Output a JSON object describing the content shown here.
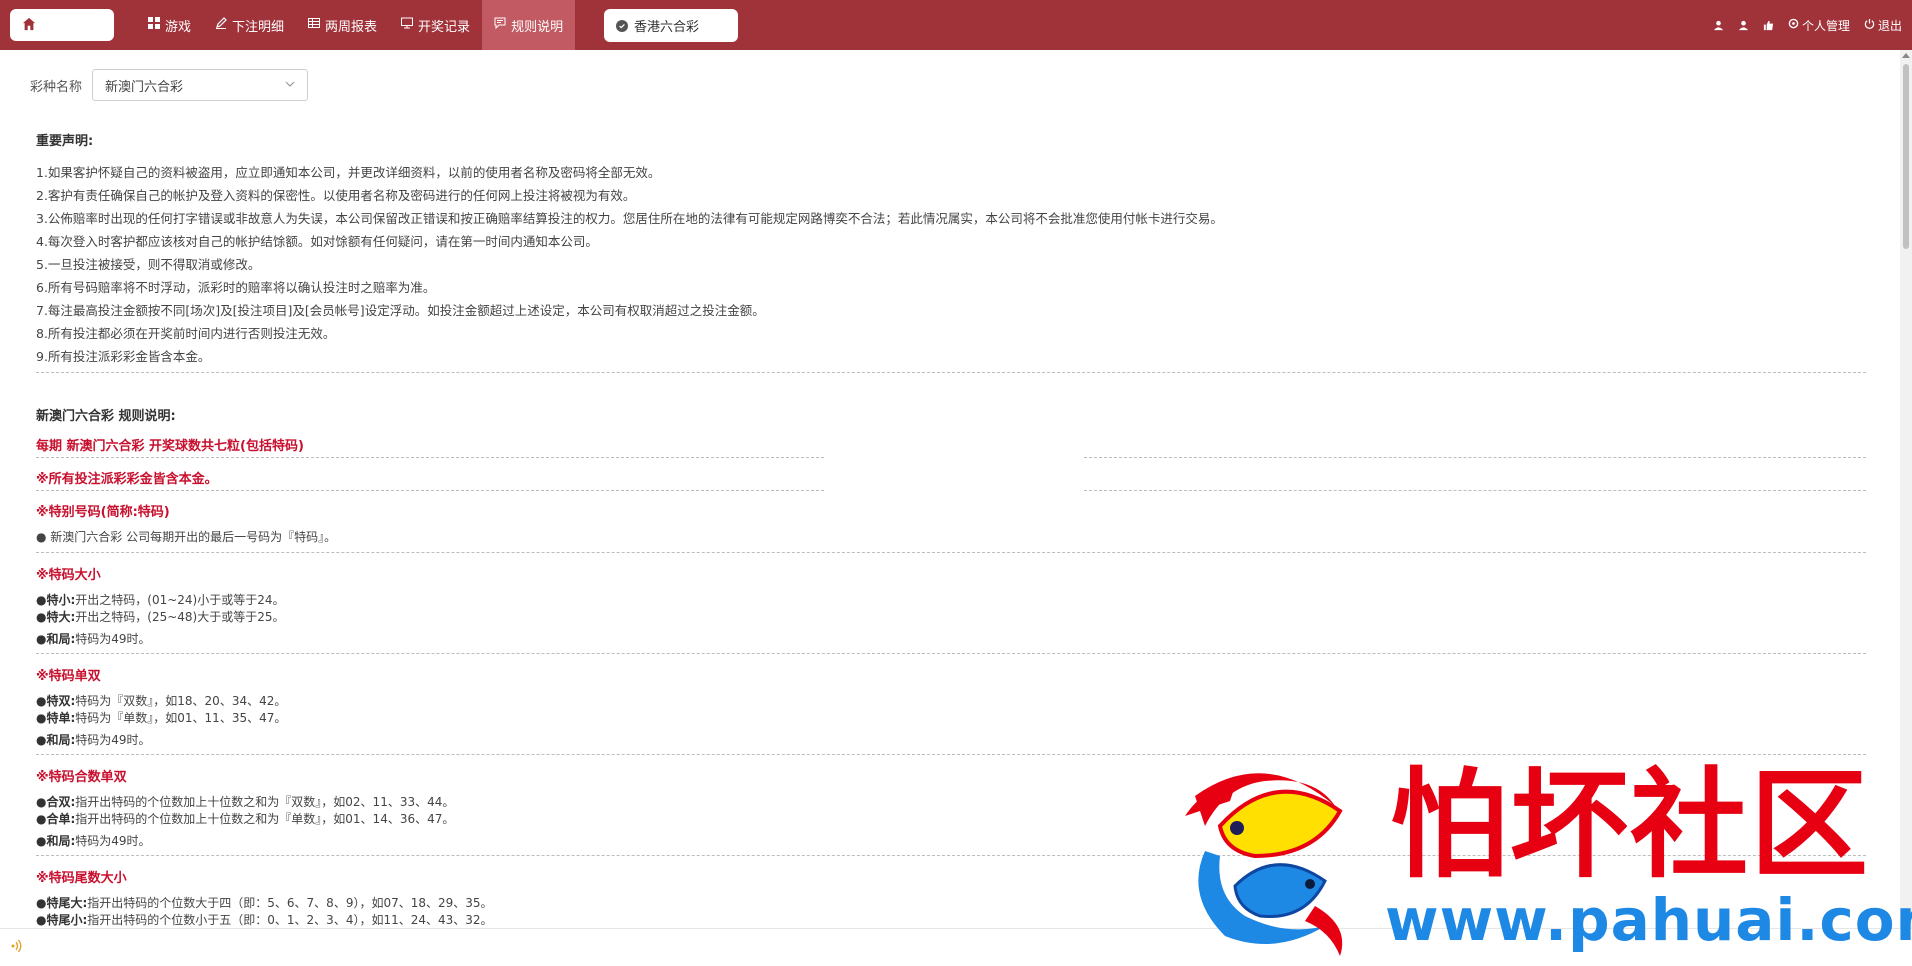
{
  "nav": {
    "items": [
      {
        "label": "游戏",
        "icon": "grid-icon"
      },
      {
        "label": "下注明细",
        "icon": "pen-icon"
      },
      {
        "label": "两周报表",
        "icon": "table-icon"
      },
      {
        "label": "开奖记录",
        "icon": "monitor-icon"
      },
      {
        "label": "规则说明",
        "icon": "message-icon",
        "active": true
      }
    ],
    "lottery_tab": "香港六合彩",
    "right": {
      "personal": "个人管理",
      "logout": "退出"
    },
    "bg_color": "#a0323a",
    "active_color": "#c25a63"
  },
  "selector": {
    "label": "彩种名称",
    "value": "新澳门六合彩"
  },
  "notice": {
    "title": "重要声明:",
    "lines": [
      "1.如果客护怀疑自己的资料被盗用，应立即通知本公司，并更改详细资料，以前的使用者名称及密码将全部无效。",
      "2.客护有责任确保自己的帐护及登入资料的保密性。以使用者名称及密码进行的任何网上投注将被视为有效。",
      "3.公佈赔率时出现的任何打字错误或非故意人为失误，本公司保留改正错误和按正确赔率结算投注的权力。您居住所在地的法律有可能规定网路博奕不合法；若此情况属实，本公司将不会批准您使用付帐卡进行交易。",
      "4.每次登入时客护都应该核对自己的帐护结馀额。如对馀额有任何疑问，请在第一时间内通知本公司。",
      "5.一旦投注被接受，则不得取消或修改。",
      "6.所有号码赔率将不时浮动，派彩时的赔率将以确认投注时之赔率为准。",
      "7.每注最高投注金额按不同[场次]及[投注项目]及[会员帐号]设定浮动。如投注金额超过上述设定，本公司有权取消超过之投注金额。",
      "8.所有投注都必须在开奖前时间内进行否则投注无效。",
      "9.所有投注派彩彩金皆含本金。"
    ]
  },
  "rules": {
    "title": "新澳门六合彩 规则说明:",
    "headline1": "每期 新澳门六合彩 开奖球数共七粒(包括特码)",
    "headline2": "※所有投注派彩彩金皆含本金。",
    "special": {
      "title": "※特别号码(简称:特码)",
      "desc": "● 新澳门六合彩 公司每期开出的最后一号码为『特码』。"
    },
    "size": {
      "title": "※特码大小",
      "rows": [
        {
          "k": "●特小:",
          "v": "开出之特码，(01~24)小于或等于24。"
        },
        {
          "k": "●特大:",
          "v": "开出之特码，(25~48)大于或等于25。"
        },
        {
          "k": "●和局:",
          "v": "特码为49时。"
        }
      ]
    },
    "oddeven": {
      "title": "※特码单双",
      "rows": [
        {
          "k": "●特双:",
          "v": "特码为『双数』，如18、20、34、42。"
        },
        {
          "k": "●特单:",
          "v": "特码为『单数』，如01、11、35、47。"
        },
        {
          "k": "●和局:",
          "v": "特码为49时。"
        }
      ]
    },
    "sum": {
      "title": "※特码合数单双",
      "rows": [
        {
          "k": "●合双:",
          "v": "指开出特码的个位数加上十位数之和为『双数』，如02、11、33、44。"
        },
        {
          "k": "●合单:",
          "v": "指开出特码的个位数加上十位数之和为『单数』，如01、14、36、47。"
        },
        {
          "k": "●和局:",
          "v": "特码为49时。"
        }
      ]
    },
    "tail": {
      "title": "※特码尾数大小",
      "rows": [
        {
          "k": "●特尾大:",
          "v": "指开出特码的个位数大于四（即：5、6、7、8、9），如07、18、29、35。"
        },
        {
          "k": "●特尾小:",
          "v": "指开出特码的个位数小于五（即：0、1、2、3、4），如11、24、43、32。"
        }
      ]
    }
  },
  "watermark": {
    "text": "怕坏社区",
    "url": "www.pahuai.com"
  }
}
